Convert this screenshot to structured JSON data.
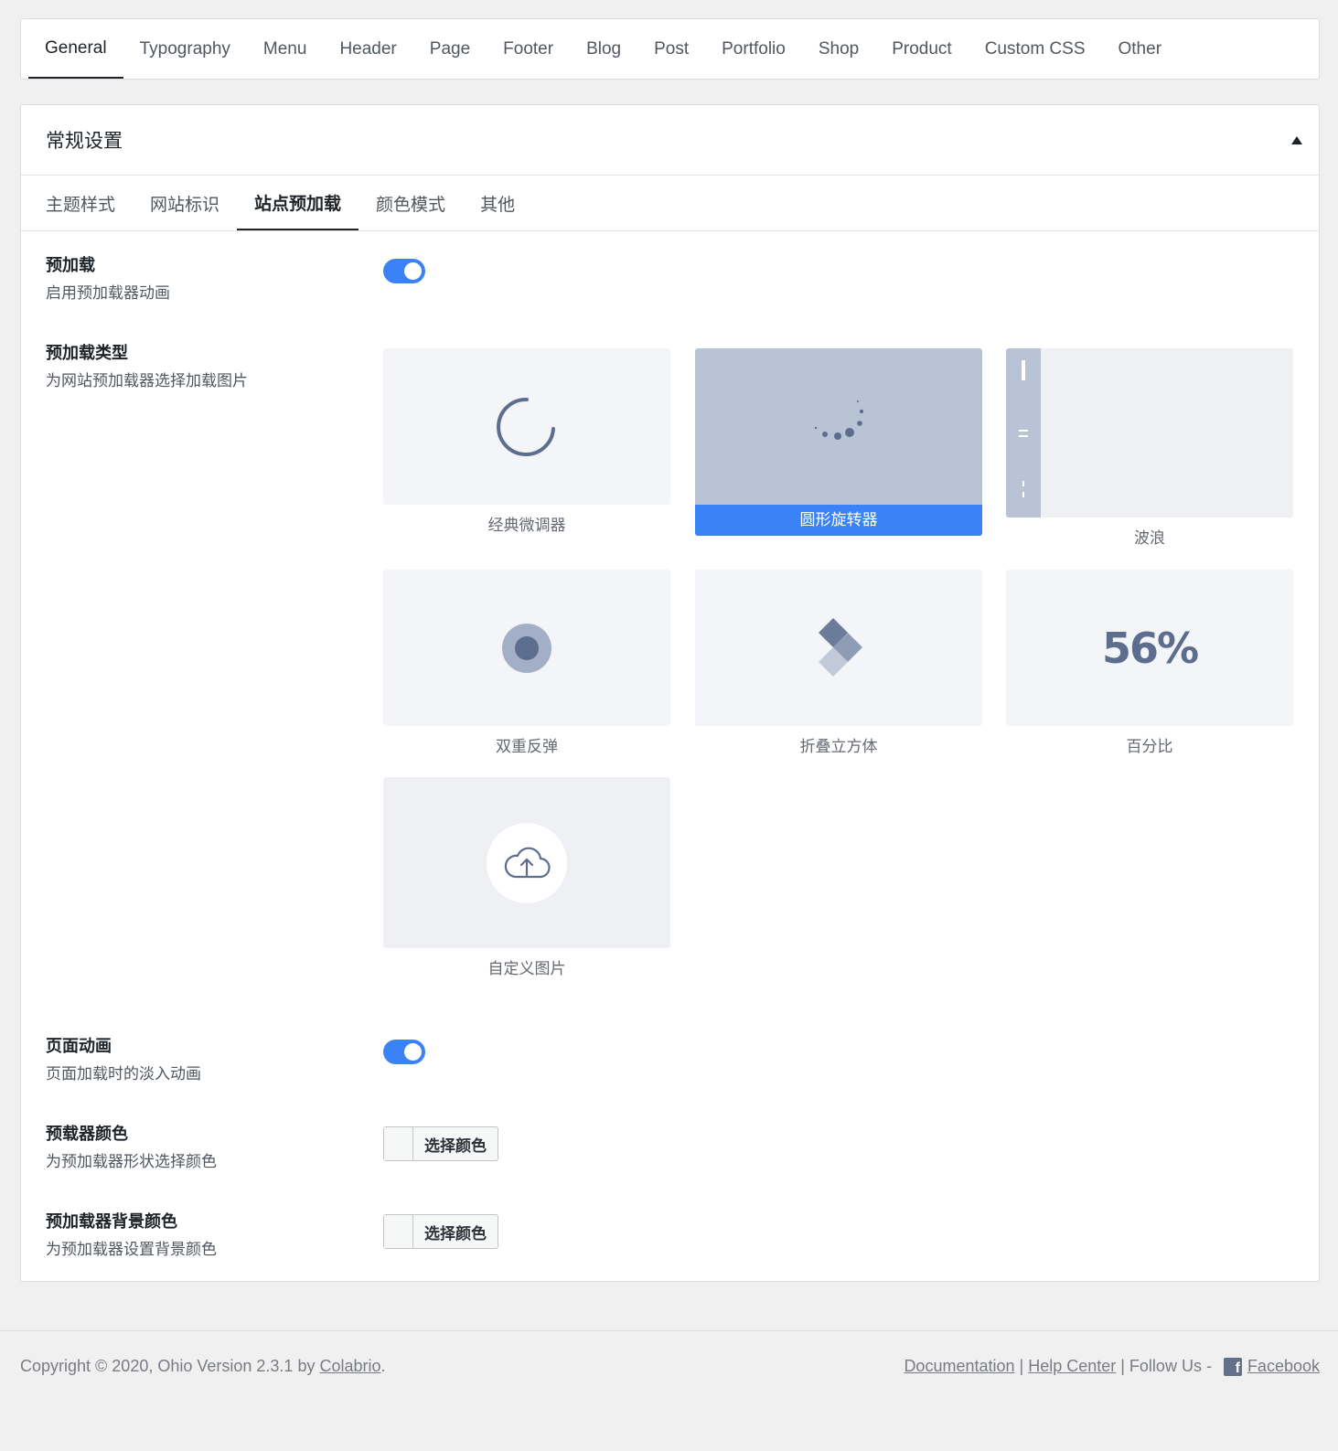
{
  "top_tabs": [
    "General",
    "Typography",
    "Menu",
    "Header",
    "Page",
    "Footer",
    "Blog",
    "Post",
    "Portfolio",
    "Shop",
    "Product",
    "Custom CSS",
    "Other"
  ],
  "panel": {
    "title": "常规设置",
    "sub_tabs": [
      "主题样式",
      "网站标识",
      "站点预加载",
      "颜色模式",
      "其他"
    ]
  },
  "options": {
    "preloader": {
      "title": "预加载",
      "desc": "启用预加载器动画",
      "enabled": true
    },
    "preloader_type": {
      "title": "预加载类型",
      "desc": "为网站预加载器选择加载图片",
      "choices": [
        "经典微调器",
        "圆形旋转器",
        "波浪",
        "双重反弹",
        "折叠立方体",
        "百分比",
        "自定义图片"
      ],
      "selected": "圆形旋转器",
      "percent_preview": "56%"
    },
    "page_animation": {
      "title": "页面动画",
      "desc": "页面加载时的淡入动画",
      "enabled": true
    },
    "preloader_color": {
      "title": "预载器颜色",
      "desc": "为预加载器形状选择颜色",
      "button": "选择颜色"
    },
    "preloader_bg_color": {
      "title": "预加载器背景颜色",
      "desc": "为预加载器设置背景颜色",
      "button": "选择颜色"
    }
  },
  "footer": {
    "copyright": "Copyright © 2020, Ohio Version 2.3.1 by ",
    "author": "Colabrio",
    "period": ".",
    "links": [
      "Documentation",
      "Help Center"
    ],
    "sep": " | ",
    "follow": " | Follow Us - ",
    "facebook": "Facebook"
  },
  "colors": {
    "accent": "#3b82f6",
    "thumb_bg": "#f3f5f9",
    "selected_thumb": "#b8c3d5",
    "icon": "#5d6d8e"
  }
}
